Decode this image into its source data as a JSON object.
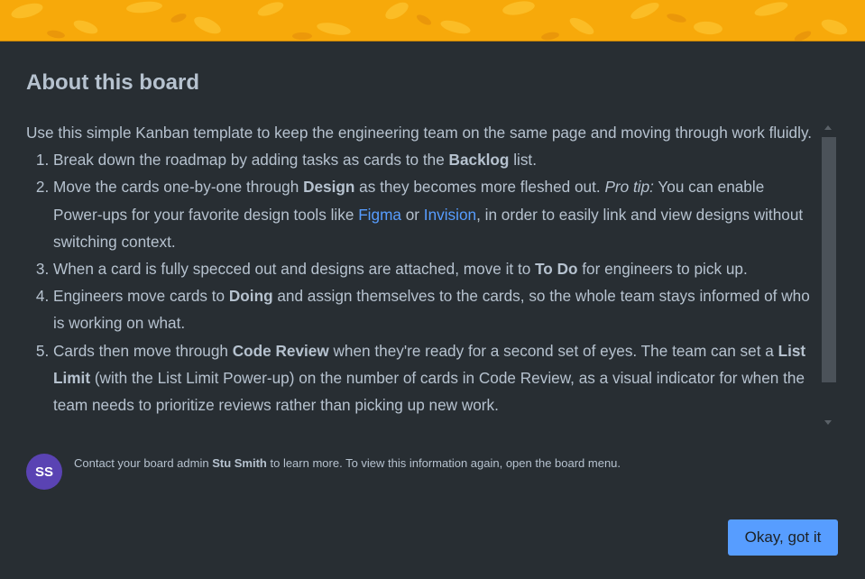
{
  "modal": {
    "title": "About this board",
    "colors": {
      "background": "#282e33",
      "banner": "#f7a90a",
      "text": "#b6c2cf",
      "link": "#579dff",
      "button": "#579dff",
      "avatar": "#5a43b3"
    }
  },
  "description": {
    "intro": "Use this simple Kanban template to keep the engineering team on the same page and moving through work fluidly.",
    "steps": [
      {
        "t1": "Break down the roadmap by adding tasks as cards to the ",
        "b1": "Backlog",
        "t2": " list."
      },
      {
        "t1": "Move the cards one-by-one through ",
        "b1": "Design",
        "t2": " as they becomes more fleshed out. ",
        "i1": "Pro tip:",
        "t3": " You can enable Power-ups for your favorite design tools like ",
        "link1": "Figma",
        "t4": " or ",
        "link2": "Invision",
        "t5": ", in order to easily link and view designs without switching context."
      },
      {
        "t1": "When a card is fully specced out and designs are attached, move it to ",
        "b1": "To Do",
        "t2": " for engineers to pick up."
      },
      {
        "t1": "Engineers move cards to ",
        "b1": "Doing",
        "t2": " and assign themselves to the cards, so the whole team stays informed of who is working on what."
      },
      {
        "t1": "Cards then move through ",
        "b1": "Code Review",
        "t2": " when they're ready for a second set of eyes. The team can set a ",
        "b2": "List Limit",
        "t3": " (with the List Limit Power-up) on the number of cards in Code Review, as a visual indicator for when the team needs to prioritize reviews rather than picking up new work."
      }
    ]
  },
  "footer": {
    "avatar_initials": "SS",
    "text_before": "Contact your board admin ",
    "admin_name": "Stu Smith",
    "text_after": " to learn more. To view this information again, open the board menu."
  },
  "actions": {
    "ok_label": "Okay, got it"
  }
}
